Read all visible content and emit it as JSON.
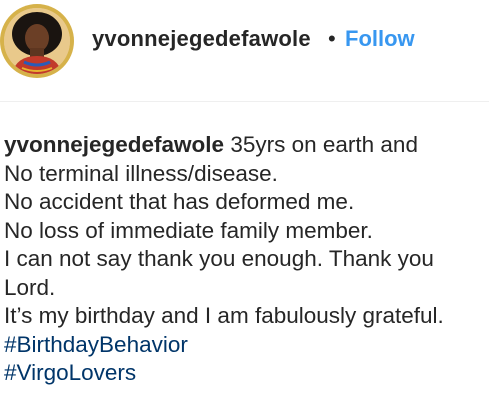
{
  "post_header": {
    "username": "yvonnejegedefawole",
    "separator": "•",
    "follow_label": "Follow"
  },
  "caption": {
    "username": "yvonnejegedefawole",
    "first_line_text": " 35yrs on earth and",
    "lines": [
      "No terminal illness/disease.",
      "No accident that has deformed me.",
      "No loss of immediate family member.",
      "I can not say thank you enough. Thank you",
      "Lord.",
      "It’s my birthday and I am fabulously grateful."
    ],
    "hashtags": [
      "#BirthdayBehavior",
      "#VirgoLovers"
    ]
  },
  "colors": {
    "follow": "#3897f0",
    "hashtag": "#003569",
    "text": "#262626"
  }
}
